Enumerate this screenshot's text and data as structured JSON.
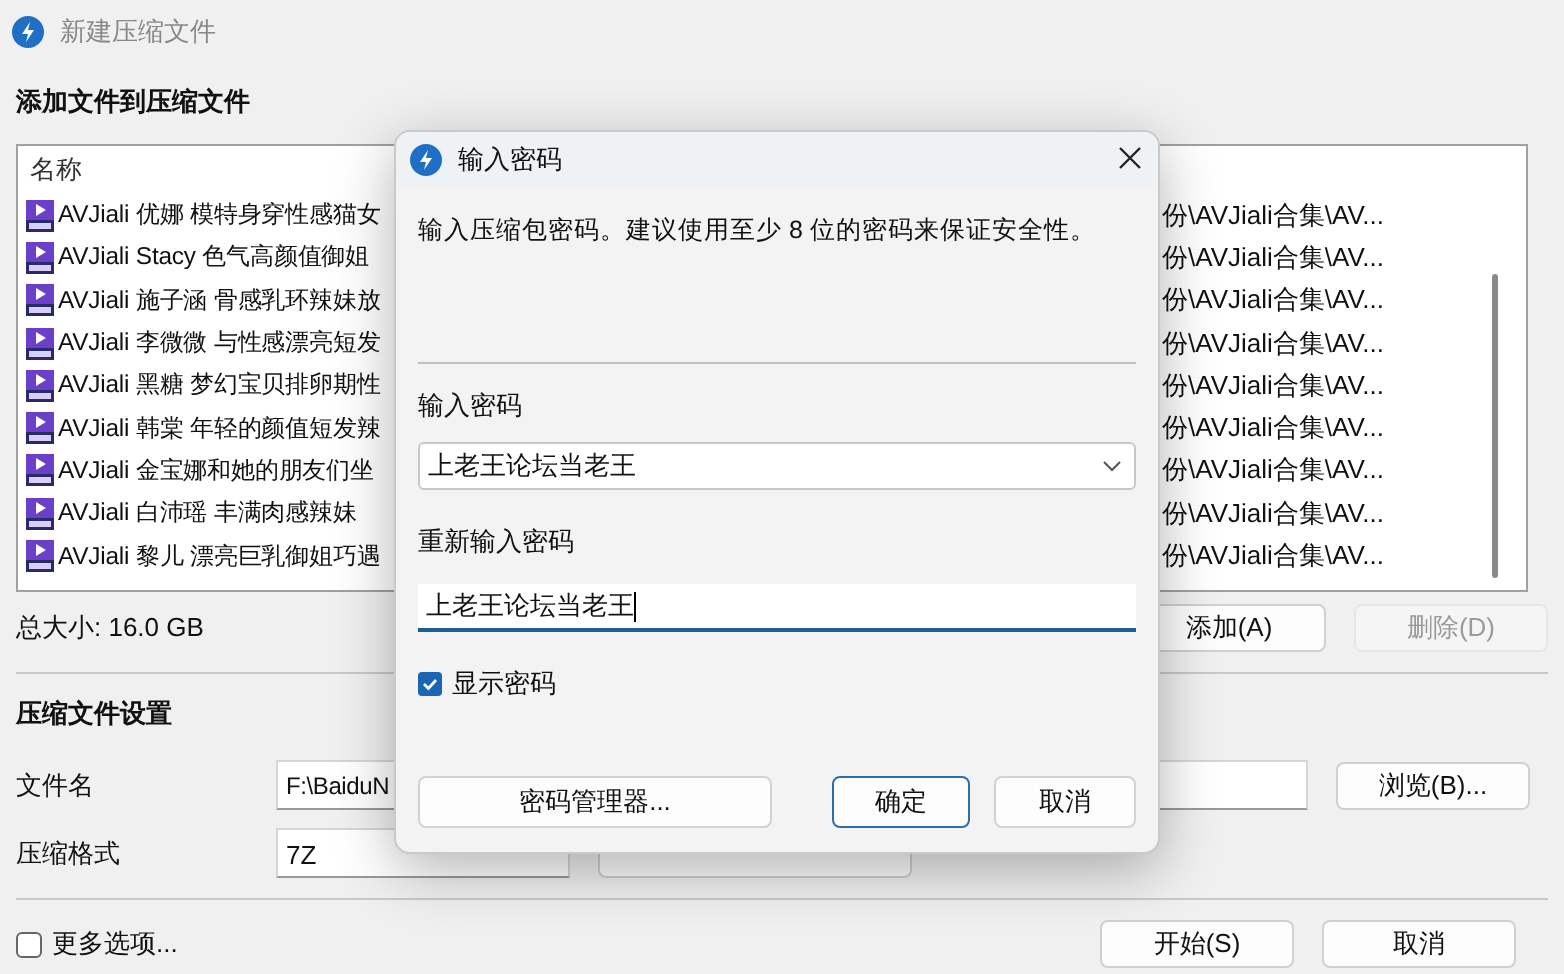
{
  "window": {
    "title": "新建压缩文件"
  },
  "add_section": {
    "heading": "添加文件到压缩文件",
    "file_list": {
      "columns": [
        "名称"
      ],
      "rows": [
        {
          "name": "AVJiali 优娜 模特身穿性感猫女",
          "path": "份\\AVJiali合集\\AV..."
        },
        {
          "name": "AVJiali Stacy 色气高颜值御姐",
          "path": "份\\AVJiali合集\\AV..."
        },
        {
          "name": "AVJiali 施子涵 骨感乳环辣妹放",
          "path": "份\\AVJiali合集\\AV..."
        },
        {
          "name": "AVJiali 李微微 与性感漂亮短发",
          "path": "份\\AVJiali合集\\AV..."
        },
        {
          "name": "AVJiali 黑糖 梦幻宝贝排卵期性",
          "path": "份\\AVJiali合集\\AV..."
        },
        {
          "name": "AVJiali 韩棠 年轻的颜值短发辣",
          "path": "份\\AVJiali合集\\AV..."
        },
        {
          "name": "AVJiali 金宝娜和她的朋友们坐",
          "path": "份\\AVJiali合集\\AV..."
        },
        {
          "name": "AVJiali  白沛瑶 丰满肉感辣妹",
          "path": "份\\AVJiali合集\\AV..."
        },
        {
          "name": "AVJiali 黎儿 漂亮巨乳御姐巧遇",
          "path": "份\\AVJiali合集\\AV..."
        }
      ]
    },
    "total_size": "总大小: 16.0 GB",
    "buttons": [
      {
        "label": "添加(A)",
        "disabled": false
      },
      {
        "label": "删除(D)",
        "disabled": true
      }
    ]
  },
  "settings": {
    "heading": "压缩文件设置",
    "fields": [
      {
        "label": "文件名",
        "value": "F:\\BaiduN"
      },
      {
        "label": "压缩格式",
        "value": "7Z"
      }
    ],
    "browse_button": "浏览(B)...",
    "more_options": {
      "label": "更多选项...",
      "checked": false
    }
  },
  "footer_buttons": [
    "开始(S)",
    "取消"
  ],
  "dialog": {
    "title": "输入密码",
    "message": "输入压缩包密码。建议使用至少 8 位的密码来保证安全性。",
    "password": {
      "label": "输入密码",
      "value": "上老王论坛当老王"
    },
    "confirm": {
      "label": "重新输入密码",
      "value": "上老王论坛当老王"
    },
    "show_password": {
      "label": "显示密码",
      "checked": true
    },
    "buttons": [
      {
        "label": "密码管理器...",
        "kind": "manager"
      },
      {
        "label": "确定",
        "kind": "default"
      },
      {
        "label": "取消",
        "kind": "normal"
      }
    ]
  }
}
